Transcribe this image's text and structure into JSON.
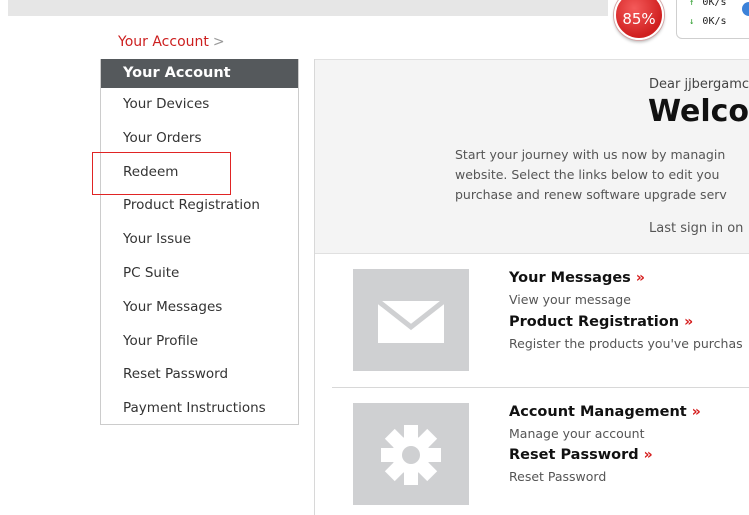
{
  "status_widget": {
    "gauge_value": "85%",
    "upload_speed": "0K/s",
    "download_speed": "0K/s"
  },
  "breadcrumb": {
    "current": "Your Account",
    "separator": ">"
  },
  "sidebar": {
    "header": "Your Account",
    "items": [
      {
        "label": "Your Devices"
      },
      {
        "label": "Your Orders"
      },
      {
        "label": "Redeem"
      },
      {
        "label": "Product Registration"
      },
      {
        "label": "Your Issue"
      },
      {
        "label": "PC Suite"
      },
      {
        "label": "Your Messages"
      },
      {
        "label": "Your Profile"
      },
      {
        "label": "Reset Password"
      },
      {
        "label": "Payment Instructions"
      }
    ]
  },
  "welcome": {
    "greeting": "Dear jjbergamc",
    "title": "Welco",
    "intro_lines": [
      "Start your journey with us now by managin",
      "website. Select the links below to edit you",
      "purchase and renew software upgrade serv"
    ],
    "last_sign_in": "Last sign in on"
  },
  "sections": [
    {
      "icon": "envelope-icon",
      "links": [
        {
          "title": "Your Messages",
          "chevron": "»",
          "desc": "View your message"
        },
        {
          "title": "Product Registration",
          "chevron": "»",
          "desc": "Register the products you've purchas"
        }
      ]
    },
    {
      "icon": "gear-icon",
      "links": [
        {
          "title": "Account Management",
          "chevron": "»",
          "desc": "Manage your account"
        },
        {
          "title": "Reset Password",
          "chevron": "»",
          "desc": "Reset Password"
        }
      ]
    }
  ],
  "colors": {
    "accent": "#cc1f1f",
    "sidebar_header": "#55595c",
    "highlight": "#e02424",
    "tile": "#cfd0d2"
  }
}
